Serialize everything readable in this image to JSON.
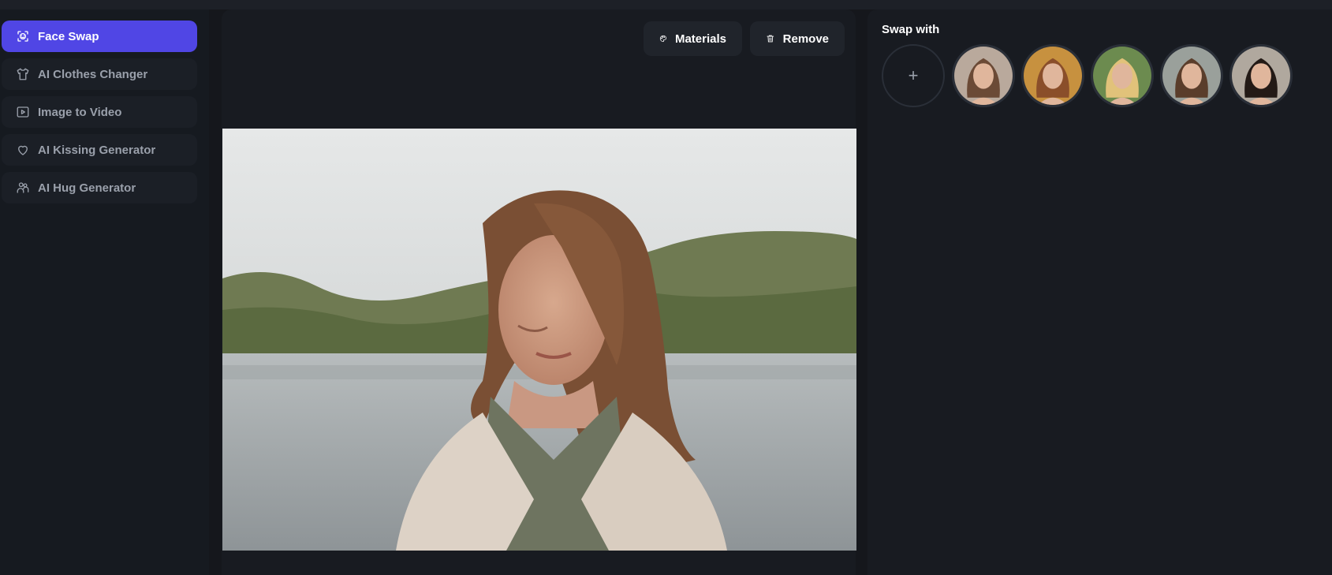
{
  "sidebar": {
    "items": [
      {
        "label": "Face Swap",
        "icon": "face-scan-icon",
        "active": true
      },
      {
        "label": "AI Clothes Changer",
        "icon": "shirt-icon",
        "active": false
      },
      {
        "label": "Image to Video",
        "icon": "video-play-icon",
        "active": false
      },
      {
        "label": "AI Kissing Generator",
        "icon": "heart-icon",
        "active": false
      },
      {
        "label": "AI Hug Generator",
        "icon": "hug-icon",
        "active": false
      }
    ]
  },
  "toolbar": {
    "materials_label": "Materials",
    "materials_icon": "palette-icon",
    "remove_label": "Remove",
    "remove_icon": "trash-icon"
  },
  "swap_panel": {
    "title": "Swap with",
    "add_label": "+",
    "faces": [
      {
        "name": "face-1",
        "hair": "#6b4a36",
        "bg": "#b9a99c"
      },
      {
        "name": "face-2",
        "hair": "#8a4e2a",
        "bg": "#c7913f"
      },
      {
        "name": "face-3",
        "hair": "#e1c27a",
        "bg": "#6c8b4f"
      },
      {
        "name": "face-4",
        "hair": "#5a3d2b",
        "bg": "#9aa09b"
      },
      {
        "name": "face-5",
        "hair": "#231a16",
        "bg": "#b0a89e"
      }
    ]
  },
  "colors": {
    "accent": "#5046e5",
    "background": "#15171c",
    "panel": "#181b21"
  }
}
